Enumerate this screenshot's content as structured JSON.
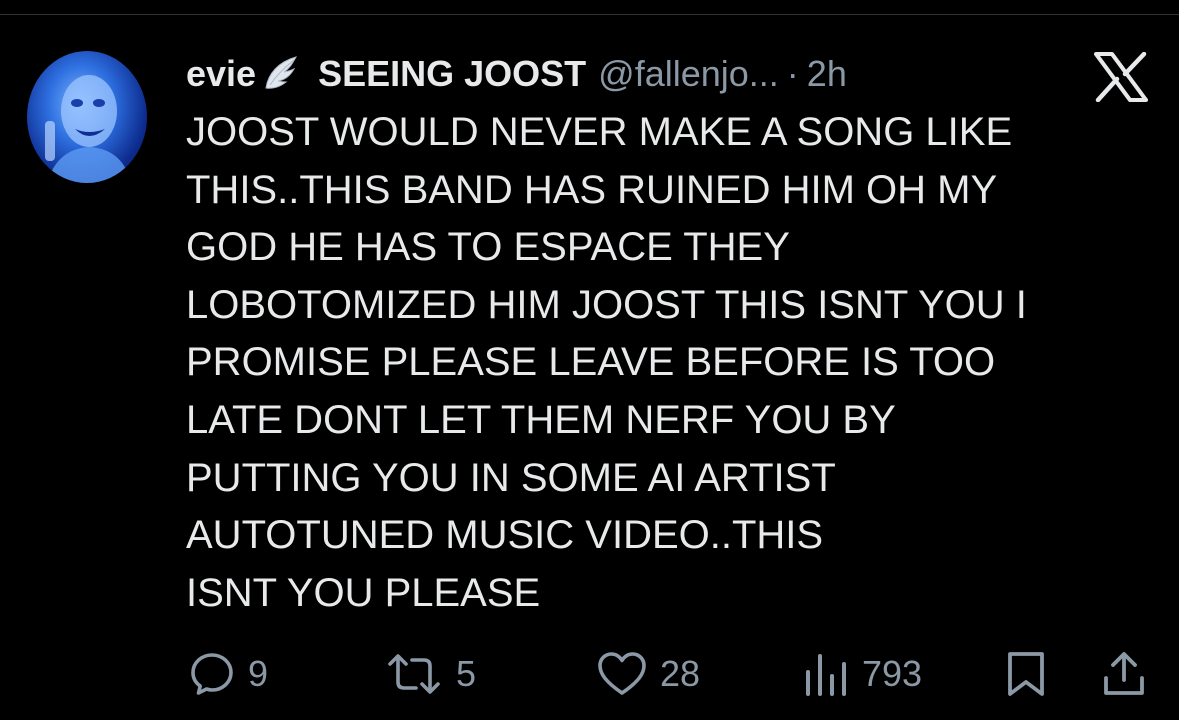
{
  "author": {
    "display_name": "evie",
    "badge_icon": "wing-icon",
    "second_name": "SEEING JOOST",
    "handle": "@fallenjo...",
    "separator": "·",
    "timestamp": "2h"
  },
  "brand": {
    "logo_icon": "x-logo-icon"
  },
  "tweet": {
    "lines": [
      "JOOST WOULD NEVER MAKE A SONG LIKE",
      "THIS..THIS BAND HAS RUINED HIM OH MY",
      "GOD HE HAS TO ESPACE THEY",
      "LOBOTOMIZED HIM JOOST THIS ISNT YOU I",
      "PROMISE PLEASE LEAVE BEFORE IS TOO",
      "LATE DONT LET THEM NERF YOU BY",
      "PUTTING YOU IN SOME AI ARTIST",
      "AUTOTUNED MUSIC VIDEO..THIS",
      "ISNT YOU PLEASE"
    ]
  },
  "actions": {
    "reply": {
      "icon": "reply-icon",
      "count": "9"
    },
    "retweet": {
      "icon": "retweet-icon",
      "count": "5"
    },
    "like": {
      "icon": "heart-icon",
      "count": "28"
    },
    "views": {
      "icon": "views-icon",
      "count": "793"
    },
    "bookmark": {
      "icon": "bookmark-icon"
    },
    "share": {
      "icon": "share-icon"
    }
  },
  "colors": {
    "background": "#000000",
    "primary_text": "#e7e9ea",
    "secondary_text": "#8b98a5",
    "divider": "#2f3336",
    "avatar_accent": "#2e6fe0"
  }
}
